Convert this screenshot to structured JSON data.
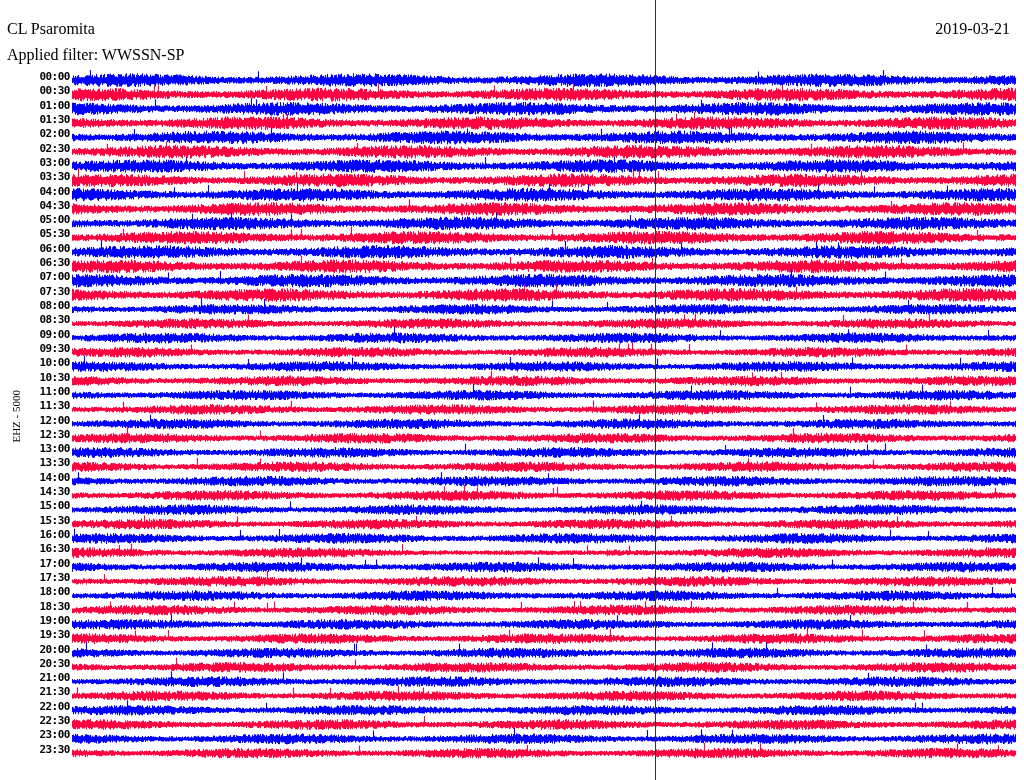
{
  "station": "CL Psaromita",
  "date": "2019-03-21",
  "filter": "Applied filter: WWSSN-SP",
  "channel": "EHZ - 5000",
  "traces": [
    {
      "label": "00:00",
      "color": "#0000ff"
    },
    {
      "label": "00:30",
      "color": "#ff0040"
    },
    {
      "label": "01:00",
      "color": "#0000ff"
    },
    {
      "label": "01:30",
      "color": "#ff0040"
    },
    {
      "label": "02:00",
      "color": "#0000ff"
    },
    {
      "label": "02:30",
      "color": "#ff0040"
    },
    {
      "label": "03:00",
      "color": "#0000ff"
    },
    {
      "label": "03:30",
      "color": "#ff0040"
    },
    {
      "label": "04:00",
      "color": "#0000ff"
    },
    {
      "label": "04:30",
      "color": "#ff0040"
    },
    {
      "label": "05:00",
      "color": "#0000ff"
    },
    {
      "label": "05:30",
      "color": "#ff0040"
    },
    {
      "label": "06:00",
      "color": "#0000ff"
    },
    {
      "label": "06:30",
      "color": "#ff0040"
    },
    {
      "label": "07:00",
      "color": "#0000ff"
    },
    {
      "label": "07:30",
      "color": "#ff0040"
    },
    {
      "label": "08:00",
      "color": "#0000ff"
    },
    {
      "label": "08:30",
      "color": "#ff0040"
    },
    {
      "label": "09:00",
      "color": "#0000ff"
    },
    {
      "label": "09:30",
      "color": "#ff0040"
    },
    {
      "label": "10:00",
      "color": "#0000ff"
    },
    {
      "label": "10:30",
      "color": "#ff0040"
    },
    {
      "label": "11:00",
      "color": "#0000ff"
    },
    {
      "label": "11:30",
      "color": "#ff0040"
    },
    {
      "label": "12:00",
      "color": "#0000ff"
    },
    {
      "label": "12:30",
      "color": "#ff0040"
    },
    {
      "label": "13:00",
      "color": "#0000ff"
    },
    {
      "label": "13:30",
      "color": "#ff0040"
    },
    {
      "label": "14:00",
      "color": "#0000ff"
    },
    {
      "label": "14:30",
      "color": "#ff0040"
    },
    {
      "label": "15:00",
      "color": "#0000ff"
    },
    {
      "label": "15:30",
      "color": "#ff0040"
    },
    {
      "label": "16:00",
      "color": "#0000ff"
    },
    {
      "label": "16:30",
      "color": "#ff0040"
    },
    {
      "label": "17:00",
      "color": "#0000ff"
    },
    {
      "label": "17:30",
      "color": "#ff0040"
    },
    {
      "label": "18:00",
      "color": "#0000ff"
    },
    {
      "label": "18:30",
      "color": "#ff0040"
    },
    {
      "label": "19:00",
      "color": "#0000ff"
    },
    {
      "label": "19:30",
      "color": "#ff0040"
    },
    {
      "label": "20:00",
      "color": "#0000ff"
    },
    {
      "label": "20:30",
      "color": "#ff0040"
    },
    {
      "label": "21:00",
      "color": "#0000ff"
    },
    {
      "label": "21:30",
      "color": "#ff0040"
    },
    {
      "label": "22:00",
      "color": "#0000ff"
    },
    {
      "label": "22:30",
      "color": "#ff0040"
    },
    {
      "label": "23:00",
      "color": "#0000ff"
    },
    {
      "label": "23:30",
      "color": "#ff0040"
    }
  ]
}
